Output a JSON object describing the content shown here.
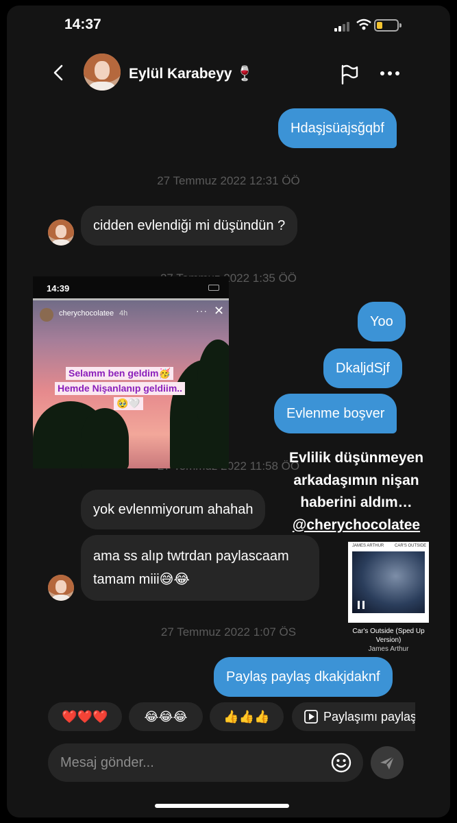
{
  "status_bar": {
    "time": "14:37"
  },
  "header": {
    "name": "Eylül Karabeyy 🍷"
  },
  "messages": [
    {
      "dir": "out",
      "text": "Hdaşjsüajsğqbf"
    },
    {
      "dir": "ts",
      "text": "27 Temmuz 2022 12:31 ÖÖ"
    },
    {
      "dir": "in",
      "text": "cidden evlendiği mi düşündün ?"
    },
    {
      "dir": "ts",
      "text": "27 Temmuz 2022 1:35 ÖÖ"
    },
    {
      "dir": "out",
      "text": "Yoo"
    },
    {
      "dir": "out",
      "text": "DkaljdSjf"
    },
    {
      "dir": "out",
      "text": "Evlenme boşver"
    },
    {
      "dir": "ts",
      "text": "27 Temmuz 2022 11:58 ÖÖ"
    },
    {
      "dir": "in",
      "text": "yok evlenmiyorum ahahah"
    },
    {
      "dir": "in",
      "text": "ama ss alıp twtrdan paylascaam tamam miii😅😂"
    },
    {
      "dir": "ts",
      "text": "27 Temmuz 2022 1:07 ÖS"
    },
    {
      "dir": "out",
      "text": "Paylaş paylaş dkakjdaknf"
    }
  ],
  "story": {
    "time": "14:39",
    "username": "cherychocolatee",
    "age": "4h",
    "line1": "Selamm ben geldim🥳",
    "line2": "Hemde Nişanlanıp geldiim..",
    "line3": "🥹🤍"
  },
  "caption": {
    "text": "Evlilik düşünmeyen arkadaşımın nişan haberini aldım…",
    "mention": "@cherychocolatee"
  },
  "music": {
    "artist_small": "JAMES ARTHUR",
    "title_small": "CAR'S OUTSIDE",
    "title": "Car's Outside (Sped Up Version)",
    "artist": "James Arthur"
  },
  "reactions": [
    "❤️❤️❤️",
    "😂😂😂",
    "👍👍👍",
    "Paylaşımı paylaş"
  ],
  "composer": {
    "placeholder": "Mesaj gönder..."
  }
}
